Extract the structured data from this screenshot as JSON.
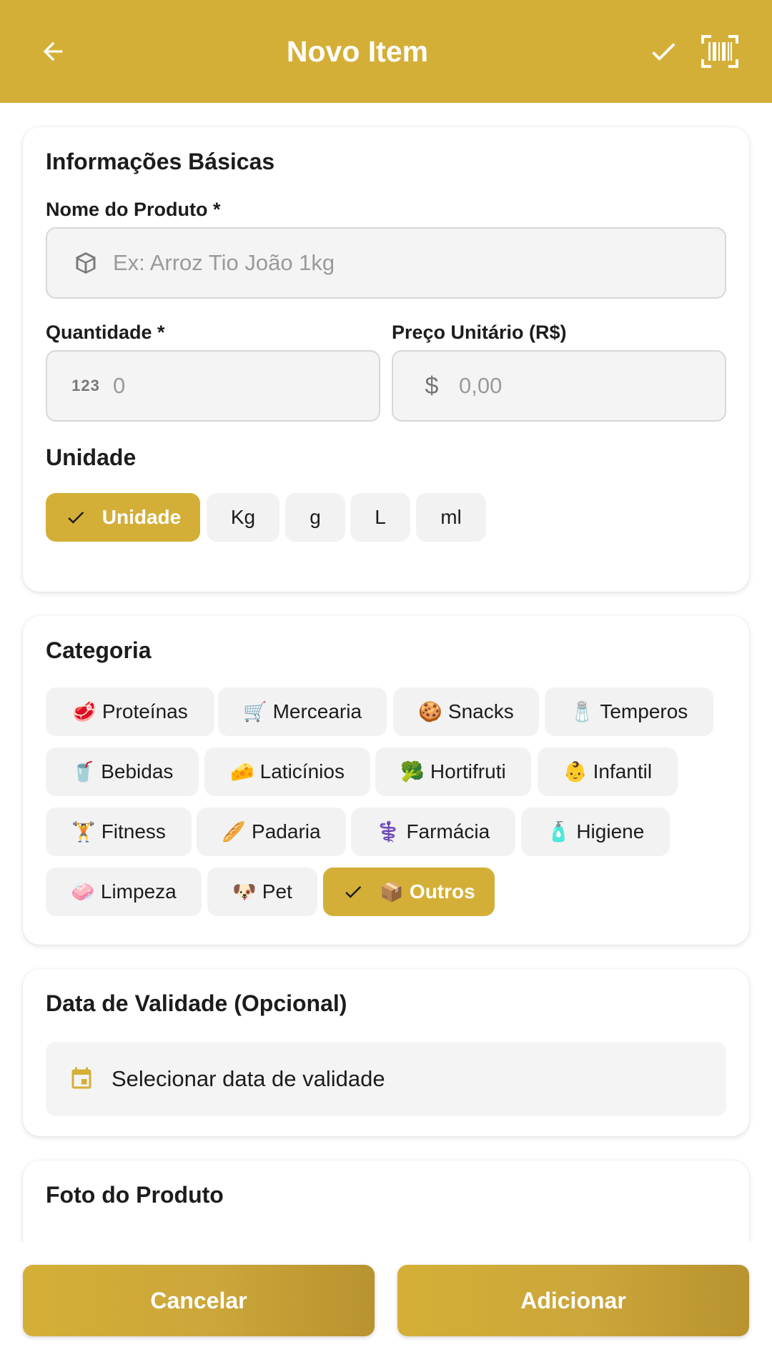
{
  "appbar": {
    "title": "Novo Item",
    "back_icon": "arrow-back-icon",
    "confirm_icon": "check-icon",
    "scan_icon": "barcode-scan-icon"
  },
  "colors": {
    "accent": "#D4AF37",
    "chip_bg": "#f2f2f2",
    "input_bg": "#f4f4f4"
  },
  "basic": {
    "title": "Informações Básicas",
    "name_label": "Nome do Produto *",
    "name_placeholder": "Ex: Arroz Tio João 1kg",
    "qty_label": "Quantidade *",
    "qty_placeholder": "0",
    "price_label": "Preço Unitário (R$)",
    "price_placeholder": "0,00",
    "unit_title": "Unidade",
    "units": [
      "Unidade",
      "Kg",
      "g",
      "L",
      "ml"
    ],
    "selected_unit": "Unidade"
  },
  "category": {
    "title": "Categoria",
    "items": [
      {
        "emoji": "🥩",
        "label": "Proteínas"
      },
      {
        "emoji": "🛒",
        "label": "Mercearia"
      },
      {
        "emoji": "🍪",
        "label": "Snacks"
      },
      {
        "emoji": "🧂",
        "label": "Temperos"
      },
      {
        "emoji": "🥤",
        "label": "Bebidas"
      },
      {
        "emoji": "🧀",
        "label": "Laticínios"
      },
      {
        "emoji": "🥦",
        "label": "Hortifruti"
      },
      {
        "emoji": "👶",
        "label": "Infantil"
      },
      {
        "emoji": "🏋",
        "label": "Fitness"
      },
      {
        "emoji": "🥖",
        "label": "Padaria"
      },
      {
        "emoji": "⚕️",
        "label": "Farmácia"
      },
      {
        "emoji": "🧴",
        "label": "Higiene"
      },
      {
        "emoji": "🧼",
        "label": "Limpeza"
      },
      {
        "emoji": "🐶",
        "label": "Pet"
      },
      {
        "emoji": "📦",
        "label": "Outros"
      }
    ],
    "selected": "Outros"
  },
  "expiry": {
    "title": "Data de Validade (Opcional)",
    "select_label": "Selecionar data de validade",
    "icon": "calendar-icon"
  },
  "photo": {
    "title": "Foto do Produto"
  },
  "actions": {
    "cancel": "Cancelar",
    "add": "Adicionar"
  }
}
